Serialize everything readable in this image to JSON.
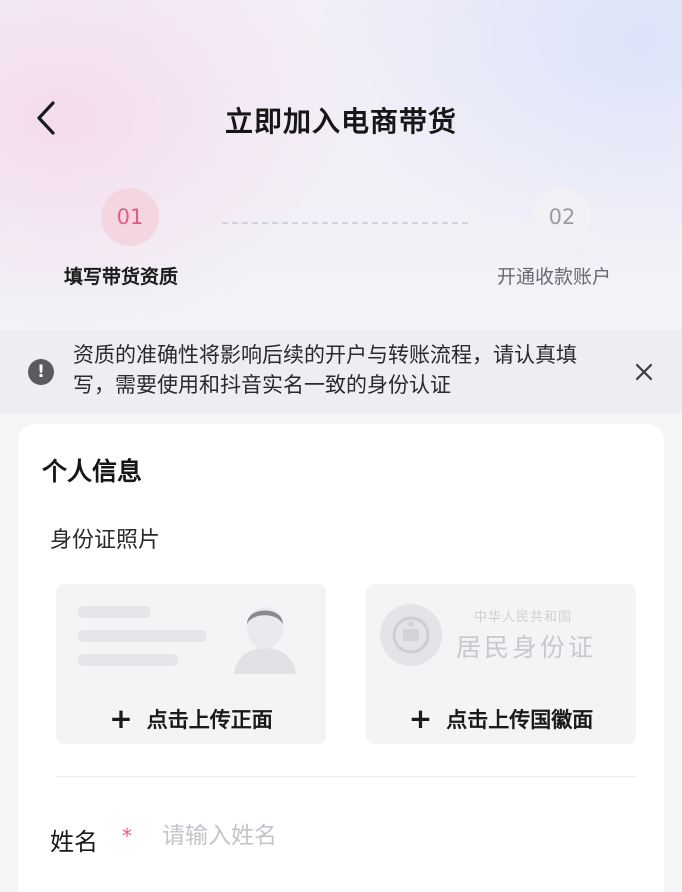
{
  "header": {
    "title": "立即加入电商带货",
    "back_icon": "chevron-left-icon"
  },
  "steps": [
    {
      "number": "01",
      "label": "填写带货资质",
      "active": true
    },
    {
      "number": "02",
      "label": "开通收款账户",
      "active": false
    }
  ],
  "notice": {
    "icon": "alert-circle-icon",
    "text": "资质的准确性将影响后续的开户与转账流程，请认真填写，需要使用和抖音实名一致的身份认证",
    "close_icon": "close-icon"
  },
  "personal_info": {
    "section_title": "个人信息",
    "id_photo_label": "身份证照片",
    "upload_front_label": "点击上传正面",
    "upload_back_label": "点击上传国徽面",
    "id_card_country": "中华人民共和国",
    "id_card_title": "居民身份证"
  },
  "name_field": {
    "label": "姓名",
    "required_mark": "*",
    "placeholder": "请输入姓名"
  },
  "colors": {
    "accent": "#e85a86",
    "active_step_bg": "#f4d6e1",
    "notice_bg": "#eeeef2"
  }
}
